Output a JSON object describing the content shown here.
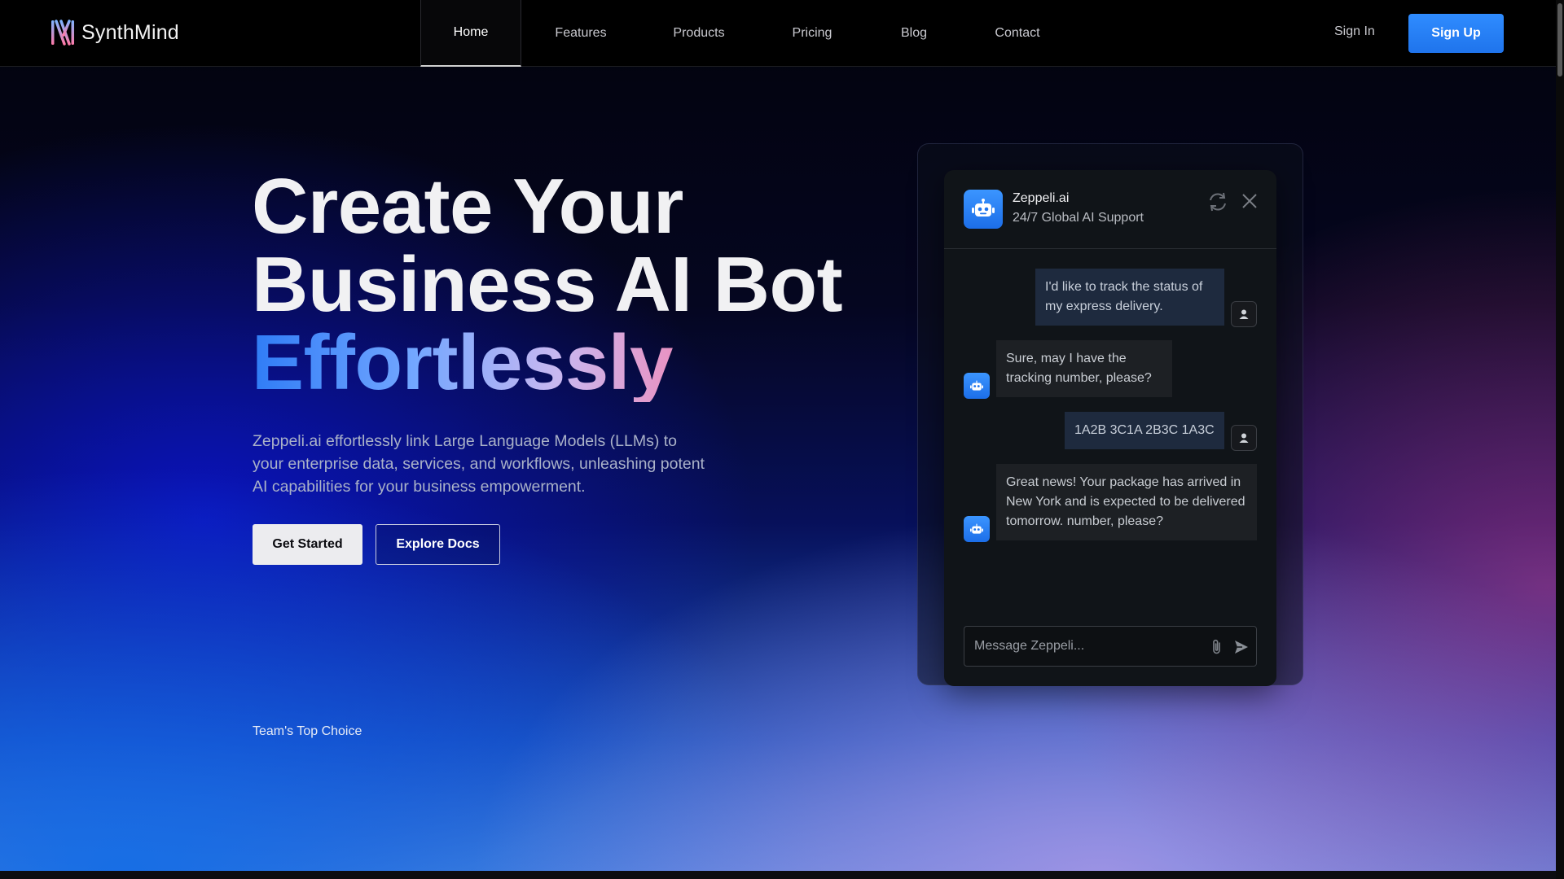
{
  "nav": {
    "logo_text": "SynthMind",
    "links": [
      {
        "label": "Home",
        "active": true
      },
      {
        "label": "Features"
      },
      {
        "label": "Products"
      },
      {
        "label": "Pricing"
      },
      {
        "label": "Blog"
      },
      {
        "label": "Contact"
      }
    ],
    "signin_label": "Sign In",
    "signup_label": "Sign Up"
  },
  "hero": {
    "title_line1": "Create Your",
    "title_line2": "Business AI Bot",
    "title_line3": "Effortlessly",
    "description": "Zeppeli.ai effortlessly link Large Language Models (LLMs) to your enterprise data, services, and workflows, unleashing potent AI capabilities for your business empowerment.",
    "get_started_label": "Get Started",
    "explore_docs_label": "Explore Docs",
    "top_choice": "Team's Top Choice"
  },
  "chat": {
    "bot_name": "Zeppeli.ai",
    "bot_subtitle": "24/7 Global AI Support",
    "messages": [
      {
        "from": "user",
        "text": "I'd like to track the status of my express delivery."
      },
      {
        "from": "bot",
        "text": "Sure, may I have the tracking number, please?"
      },
      {
        "from": "user",
        "text": "1A2B 3C1A 2B3C 1A3C"
      },
      {
        "from": "bot",
        "text": "Great news! Your package has arrived in New York and is expected to be delivered tomorrow. number, please?"
      }
    ],
    "input_placeholder": "Message Zeppeli..."
  },
  "colors": {
    "accent": "#2f8cff",
    "gradient_start": "#2f7cf6",
    "gradient_end": "#ff5e8a"
  },
  "icons": [
    "refresh-icon",
    "close-icon",
    "robot-icon",
    "user-icon",
    "paperclip-icon",
    "send-icon"
  ]
}
